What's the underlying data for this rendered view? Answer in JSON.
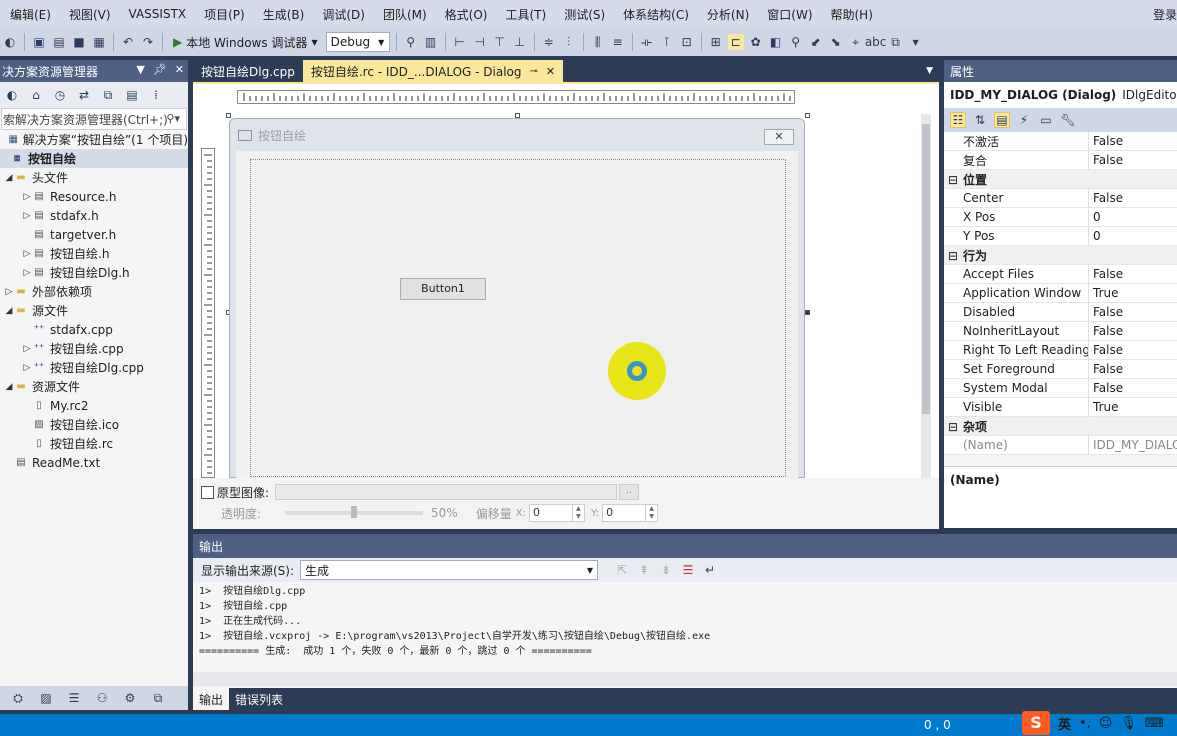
{
  "menu": {
    "items": [
      "编辑(E)",
      "视图(V)",
      "VASSISTX",
      "项目(P)",
      "生成(B)",
      "调试(D)",
      "团队(M)",
      "格式(O)",
      "工具(T)",
      "测试(S)",
      "体系结构(C)",
      "分析(N)",
      "窗口(W)",
      "帮助(H)"
    ],
    "login": "登录"
  },
  "toolbar": {
    "run_label": "本地 Windows 调试器",
    "config": "Debug"
  },
  "solution": {
    "title": "决方案资源管理器",
    "search_placeholder": "索解决方案资源管理器(Ctrl+;)",
    "items": [
      {
        "label": "解决方案“按钮自绘”(1 个项目)",
        "indent": 0,
        "icon": "solution-icon",
        "exp": ""
      },
      {
        "label": "按钮自绘",
        "indent": 0,
        "icon": "project-icon",
        "exp": "",
        "selected": true
      },
      {
        "label": "头文件",
        "indent": 1,
        "icon": "folder-icon",
        "exp": "◢"
      },
      {
        "label": "Resource.h",
        "indent": 2,
        "icon": "header-file-icon",
        "exp": "▷"
      },
      {
        "label": "stdafx.h",
        "indent": 2,
        "icon": "header-file-icon",
        "exp": "▷"
      },
      {
        "label": "targetver.h",
        "indent": 2,
        "icon": "header-file-icon",
        "exp": ""
      },
      {
        "label": "按钮自绘.h",
        "indent": 2,
        "icon": "header-file-icon",
        "exp": "▷"
      },
      {
        "label": "按钮自绘Dlg.h",
        "indent": 2,
        "icon": "header-file-icon",
        "exp": "▷"
      },
      {
        "label": "外部依赖项",
        "indent": 1,
        "icon": "folder-icon",
        "exp": "▷"
      },
      {
        "label": "源文件",
        "indent": 1,
        "icon": "folder-icon",
        "exp": "◢"
      },
      {
        "label": "stdafx.cpp",
        "indent": 2,
        "icon": "cpp-file-icon",
        "exp": ""
      },
      {
        "label": "按钮自绘.cpp",
        "indent": 2,
        "icon": "cpp-file-icon",
        "exp": "▷"
      },
      {
        "label": "按钮自绘Dlg.cpp",
        "indent": 2,
        "icon": "cpp-file-icon",
        "exp": "▷"
      },
      {
        "label": "资源文件",
        "indent": 1,
        "icon": "folder-icon",
        "exp": "◢"
      },
      {
        "label": "My.rc2",
        "indent": 2,
        "icon": "file-icon",
        "exp": ""
      },
      {
        "label": "按钮自绘.ico",
        "indent": 2,
        "icon": "image-file-icon",
        "exp": ""
      },
      {
        "label": "按钮自绘.rc",
        "indent": 2,
        "icon": "file-icon",
        "exp": ""
      },
      {
        "label": "ReadMe.txt",
        "indent": 1,
        "icon": "text-file-icon",
        "exp": ""
      }
    ]
  },
  "tabs": [
    {
      "label": "按钮自绘Dlg.cpp",
      "active": false
    },
    {
      "label": "按钮自绘.rc - IDD_...DIALOG - Dialog",
      "active": true
    }
  ],
  "dialog": {
    "title": "按钮自绘",
    "close": "✕",
    "button1": "Button1"
  },
  "proto": {
    "checkbox_label": "原型图像:",
    "browse": "..",
    "opacity_label": "透明度:",
    "opacity_value": "50%",
    "offset_label": "偏移量",
    "x_label": "X:",
    "x_value": "0",
    "y_label": "Y:",
    "y_value": "0"
  },
  "properties": {
    "title": "属性",
    "object_name": "IDD_MY_DIALOG (Dialog)",
    "object_type": "IDlgEditor",
    "rows": [
      {
        "k": "不激活",
        "v": "False"
      },
      {
        "k": "复合",
        "v": "False"
      },
      {
        "k": "位置",
        "v": "",
        "cat": true
      },
      {
        "k": "Center",
        "v": "False"
      },
      {
        "k": "X Pos",
        "v": "0"
      },
      {
        "k": "Y Pos",
        "v": "0"
      },
      {
        "k": "行为",
        "v": "",
        "cat": true
      },
      {
        "k": "Accept Files",
        "v": "False"
      },
      {
        "k": "Application Window",
        "v": "True"
      },
      {
        "k": "Disabled",
        "v": "False"
      },
      {
        "k": "NoInheritLayout",
        "v": "False"
      },
      {
        "k": "Right To Left Reading",
        "v": "False"
      },
      {
        "k": "Set Foreground",
        "v": "False"
      },
      {
        "k": "System Modal",
        "v": "False"
      },
      {
        "k": "Visible",
        "v": "True"
      },
      {
        "k": "杂项",
        "v": "",
        "cat": true
      },
      {
        "k": "(Name)",
        "v": "IDD_MY_DIALOG",
        "dim": true
      }
    ],
    "desc_title": "(Name)"
  },
  "output": {
    "title": "输出",
    "source_label": "显示输出来源(S):",
    "source_value": "生成",
    "lines": [
      "1>  按钮自绘Dlg.cpp",
      "1>  按钮自绘.cpp",
      "1>  正在生成代码...",
      "1>  按钮自绘.vcxproj -> E:\\program\\vs2013\\Project\\自学开发\\练习\\按钮自绘\\Debug\\按钮自绘.exe",
      "========== 生成:  成功 1 个，失败 0 个，最新 0 个，跳过 0 个 =========="
    ],
    "tabs": [
      "输出",
      "错误列表"
    ]
  },
  "status": {
    "position": "0 , 0"
  },
  "ime": {
    "logo": "S",
    "lang": "英"
  }
}
